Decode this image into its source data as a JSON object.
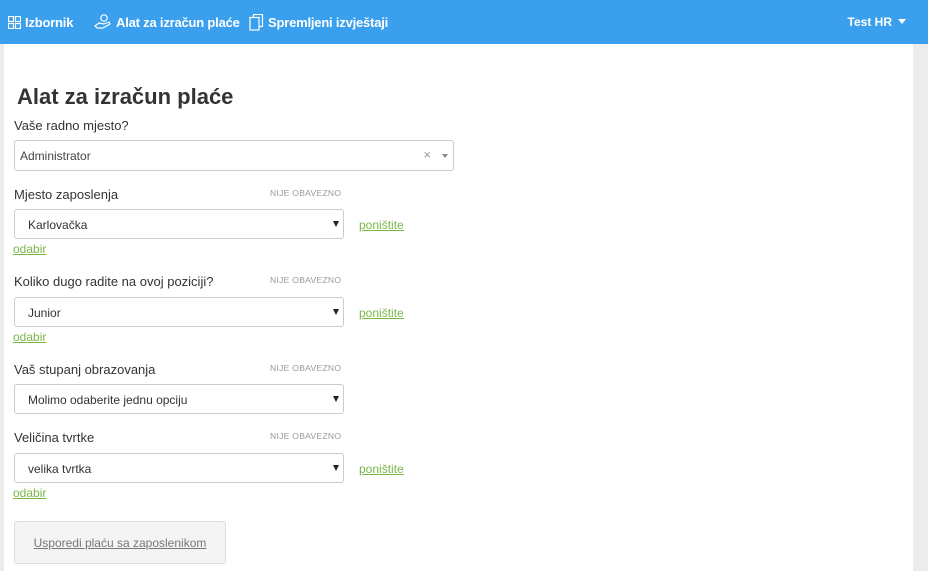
{
  "nav": {
    "menu_label": "Izbornik",
    "calculator_label": "Alat za izračun plaće",
    "saved_label": "Spremljeni izvještaji",
    "user_label": "Test HR"
  },
  "page": {
    "title": "Alat za izračun plaće"
  },
  "form": {
    "optional_text": "NIJE OBAVEZNO",
    "clear_link": "poništite",
    "selection_link": "odabir",
    "position": {
      "label": "Vaše radno mjesto?",
      "value": "Administrator",
      "clear": "×"
    },
    "location": {
      "label": "Mjesto zaposlenja",
      "value": "Karlovačka"
    },
    "seniority": {
      "label": "Koliko dugo radite na ovoj poziciji?",
      "value": "Junior"
    },
    "education": {
      "label": "Vaš stupanj obrazovanja",
      "value": "Molimo odaberite jednu opciju"
    },
    "company_size": {
      "label": "Veličina tvrtke",
      "value": "velika tvrtka"
    },
    "compare_button": "Usporedi plaću sa zaposlenikom"
  }
}
